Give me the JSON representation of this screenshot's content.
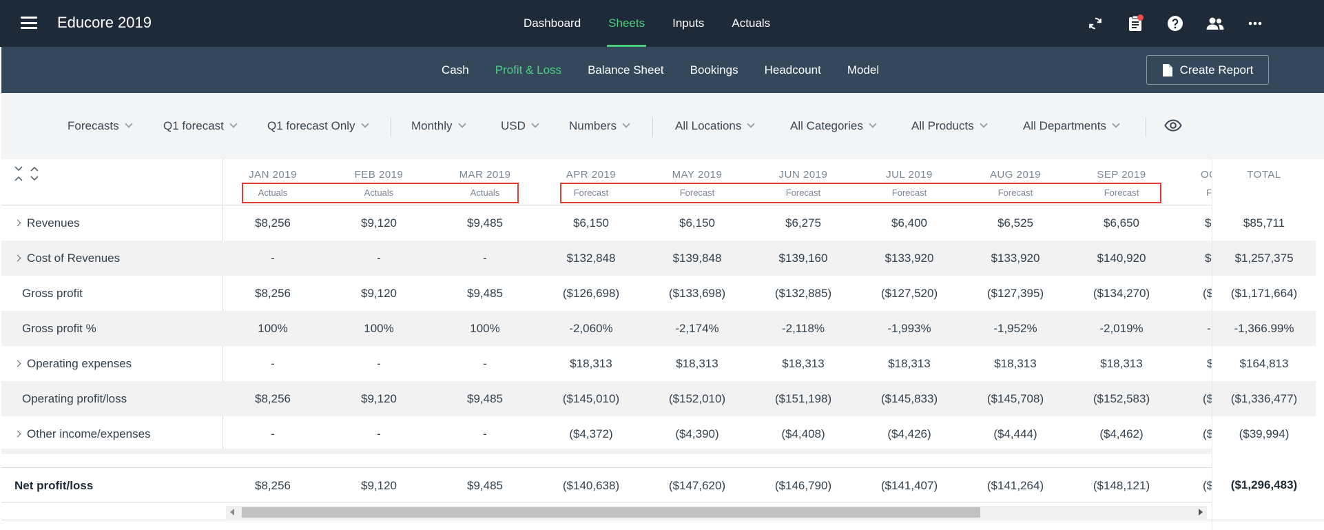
{
  "app": {
    "title": "Educore 2019"
  },
  "main_tabs": [
    {
      "label": "Dashboard",
      "active": false
    },
    {
      "label": "Sheets",
      "active": true
    },
    {
      "label": "Inputs",
      "active": false
    },
    {
      "label": "Actuals",
      "active": false
    }
  ],
  "top_icons": [
    "refresh-icon",
    "clipboard-icon",
    "help-icon",
    "users-icon",
    "more-icon"
  ],
  "sub_tabs": [
    {
      "label": "Cash",
      "active": false
    },
    {
      "label": "Profit & Loss",
      "active": true
    },
    {
      "label": "Balance Sheet",
      "active": false
    },
    {
      "label": "Bookings",
      "active": false
    },
    {
      "label": "Headcount",
      "active": false
    },
    {
      "label": "Model",
      "active": false
    }
  ],
  "create_report_label": "Create Report",
  "filters": [
    "Forecasts",
    "Q1 forecast",
    "Q1 forecast Only",
    "Monthly",
    "USD",
    "Numbers",
    "All Locations",
    "All Categories",
    "All Products",
    "All Departments"
  ],
  "colors": {
    "topbar": "#1e2a38",
    "subbar": "#34485b",
    "accent": "#4dd07e",
    "highlight": "#e53935"
  },
  "columns": [
    {
      "month": "JAN 2019",
      "type": "Actuals"
    },
    {
      "month": "FEB 2019",
      "type": "Actuals"
    },
    {
      "month": "MAR 2019",
      "type": "Actuals"
    },
    {
      "month": "APR 2019",
      "type": "Forecast"
    },
    {
      "month": "MAY 2019",
      "type": "Forecast"
    },
    {
      "month": "JUN 2019",
      "type": "Forecast"
    },
    {
      "month": "JUL 2019",
      "type": "Forecast"
    },
    {
      "month": "AUG 2019",
      "type": "Forecast"
    },
    {
      "month": "SEP 2019",
      "type": "Forecast"
    },
    {
      "month": "OC",
      "type": "F"
    }
  ],
  "total_header": "TOTAL",
  "rows": [
    {
      "label": "Revenues",
      "expandable": true,
      "values": [
        "$8,256",
        "$9,120",
        "$9,485",
        "$6,150",
        "$6,150",
        "$6,275",
        "$6,400",
        "$6,525",
        "$6,650",
        "$"
      ],
      "total": "$85,711"
    },
    {
      "label": "Cost of Revenues",
      "expandable": true,
      "values": [
        "-",
        "-",
        "-",
        "$132,848",
        "$139,848",
        "$139,160",
        "$133,920",
        "$133,920",
        "$140,920",
        "$"
      ],
      "total": "$1,257,375"
    },
    {
      "label": "Gross profit",
      "expandable": false,
      "values": [
        "$8,256",
        "$9,120",
        "$9,485",
        "($126,698)",
        "($133,698)",
        "($132,885)",
        "($127,520)",
        "($127,395)",
        "($134,270)",
        "($"
      ],
      "total": "($1,171,664)"
    },
    {
      "label": "Gross profit %",
      "expandable": false,
      "values": [
        "100%",
        "100%",
        "100%",
        "-2,060%",
        "-2,174%",
        "-2,118%",
        "-1,993%",
        "-1,952%",
        "-2,019%",
        "-"
      ],
      "total": "-1,366.99%"
    },
    {
      "label": "Operating expenses",
      "expandable": true,
      "values": [
        "-",
        "-",
        "-",
        "$18,313",
        "$18,313",
        "$18,313",
        "$18,313",
        "$18,313",
        "$18,313",
        "$"
      ],
      "total": "$164,813"
    },
    {
      "label": "Operating profit/loss",
      "expandable": false,
      "values": [
        "$8,256",
        "$9,120",
        "$9,485",
        "($145,010)",
        "($152,010)",
        "($151,198)",
        "($145,833)",
        "($145,708)",
        "($152,583)",
        "($"
      ],
      "total": "($1,336,477)"
    },
    {
      "label": "Other income/expenses",
      "expandable": true,
      "values": [
        "-",
        "-",
        "-",
        "($4,372)",
        "($4,390)",
        "($4,408)",
        "($4,426)",
        "($4,444)",
        "($4,462)",
        "($"
      ],
      "total": "($39,994)"
    }
  ],
  "net_row": {
    "label": "Net profit/loss",
    "values": [
      "$8,256",
      "$9,120",
      "$9,485",
      "($140,638)",
      "($147,620)",
      "($146,790)",
      "($141,407)",
      "($141,264)",
      "($148,121)",
      "($"
    ],
    "total": "($1,296,483)"
  }
}
